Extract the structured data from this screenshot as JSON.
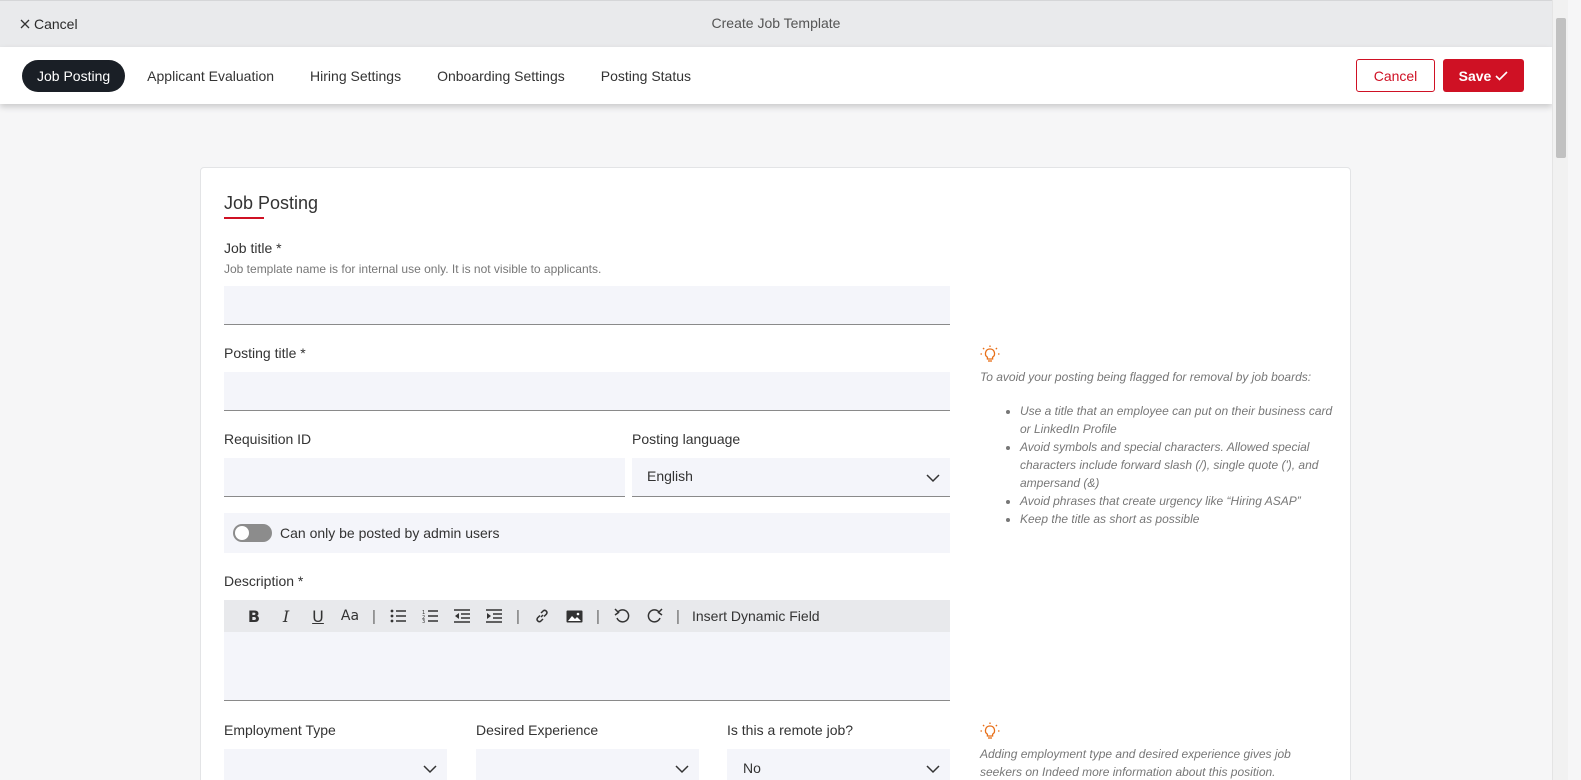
{
  "topbar": {
    "cancel_label": "Cancel",
    "title": "Create Job Template"
  },
  "tabs": [
    {
      "label": "Job Posting",
      "active": true
    },
    {
      "label": "Applicant Evaluation",
      "active": false
    },
    {
      "label": "Hiring Settings",
      "active": false
    },
    {
      "label": "Onboarding Settings",
      "active": false
    },
    {
      "label": "Posting Status",
      "active": false
    }
  ],
  "actions": {
    "cancel_label": "Cancel",
    "save_label": "Save"
  },
  "colors": {
    "accent": "#cf1124",
    "active_tab": "#1a1f26",
    "tip_icon": "#e8701a"
  },
  "form": {
    "section_title": "Job Posting",
    "job_title": {
      "label": "Job title *",
      "hint": "Job template name is for internal use only. It is not visible to applicants.",
      "value": ""
    },
    "posting_title": {
      "label": "Posting title *",
      "value": ""
    },
    "requisition_id": {
      "label": "Requisition ID",
      "value": ""
    },
    "posting_language": {
      "label": "Posting language",
      "value": "English"
    },
    "admin_only": {
      "label": "Can only be posted by admin users",
      "checked": false
    },
    "description": {
      "label": "Description *",
      "insert_dynamic_field": "Insert Dynamic Field",
      "value": ""
    },
    "employment_type": {
      "label": "Employment Type",
      "value": ""
    },
    "desired_experience": {
      "label": "Desired Experience",
      "value": ""
    },
    "remote_job": {
      "label": "Is this a remote job?",
      "value": "No"
    }
  },
  "tips": {
    "title_tip": {
      "intro": "To avoid your posting being flagged for removal by job boards:",
      "items": [
        "Use a title that an employee can put on their business card or LinkedIn Profile",
        "Avoid symbols and special characters. Allowed special characters include forward slash (/), single quote ('), and ampersand (&)",
        "Avoid phrases that create urgency like “Hiring ASAP”",
        "Keep the title as short as possible"
      ]
    },
    "employment_tip": {
      "intro": "Adding employment type and desired experience gives job seekers on Indeed more information about this position."
    }
  }
}
